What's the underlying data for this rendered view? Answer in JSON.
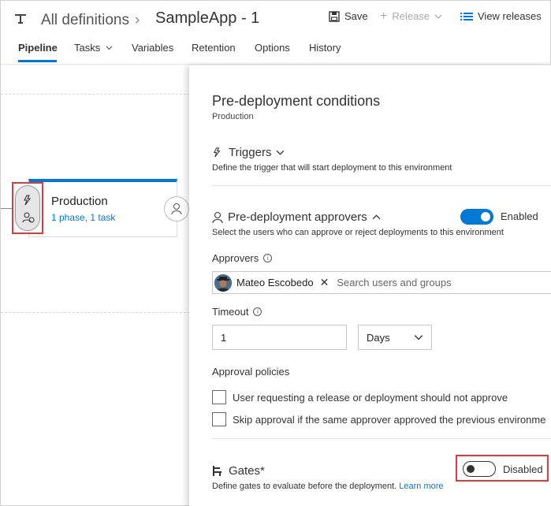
{
  "header": {
    "breadcrumb_root": "All definitions",
    "breadcrumb_sep": "›",
    "app_title": "SampleApp - 1",
    "save_label": "Save",
    "release_label": "Release",
    "view_releases_label": "View releases"
  },
  "tabs": [
    {
      "label": "Pipeline",
      "active": true
    },
    {
      "label": "Tasks",
      "active": false
    },
    {
      "label": "Variables",
      "active": false
    },
    {
      "label": "Retention",
      "active": false
    },
    {
      "label": "Options",
      "active": false
    },
    {
      "label": "History",
      "active": false
    }
  ],
  "environment": {
    "name": "Production",
    "summary": "1 phase, 1 task"
  },
  "panel": {
    "title": "Pre-deployment conditions",
    "subtitle": "Production",
    "triggers": {
      "title": "Triggers",
      "description": "Define the trigger that will start deployment to this environment"
    },
    "approvers_section": {
      "title": "Pre-deployment approvers",
      "description": "Select the users who can approve or reject deployments to this environment",
      "toggle_state": "Enabled",
      "approvers_label": "Approvers",
      "approver_name": "Mateo Escobedo",
      "search_placeholder": "Search users and groups",
      "timeout_label": "Timeout",
      "timeout_value": "1",
      "timeout_unit": "Days",
      "policies_label": "Approval policies",
      "policies": [
        "User requesting a release or deployment should not approve",
        "Skip approval if the same approver approved the previous environme"
      ]
    },
    "gates": {
      "title": "Gates*",
      "description": "Define gates to evaluate before the deployment.",
      "learn_more": "Learn more",
      "toggle_state": "Disabled"
    }
  },
  "colors": {
    "accent": "#0078d4",
    "highlight": "#e0393e"
  }
}
